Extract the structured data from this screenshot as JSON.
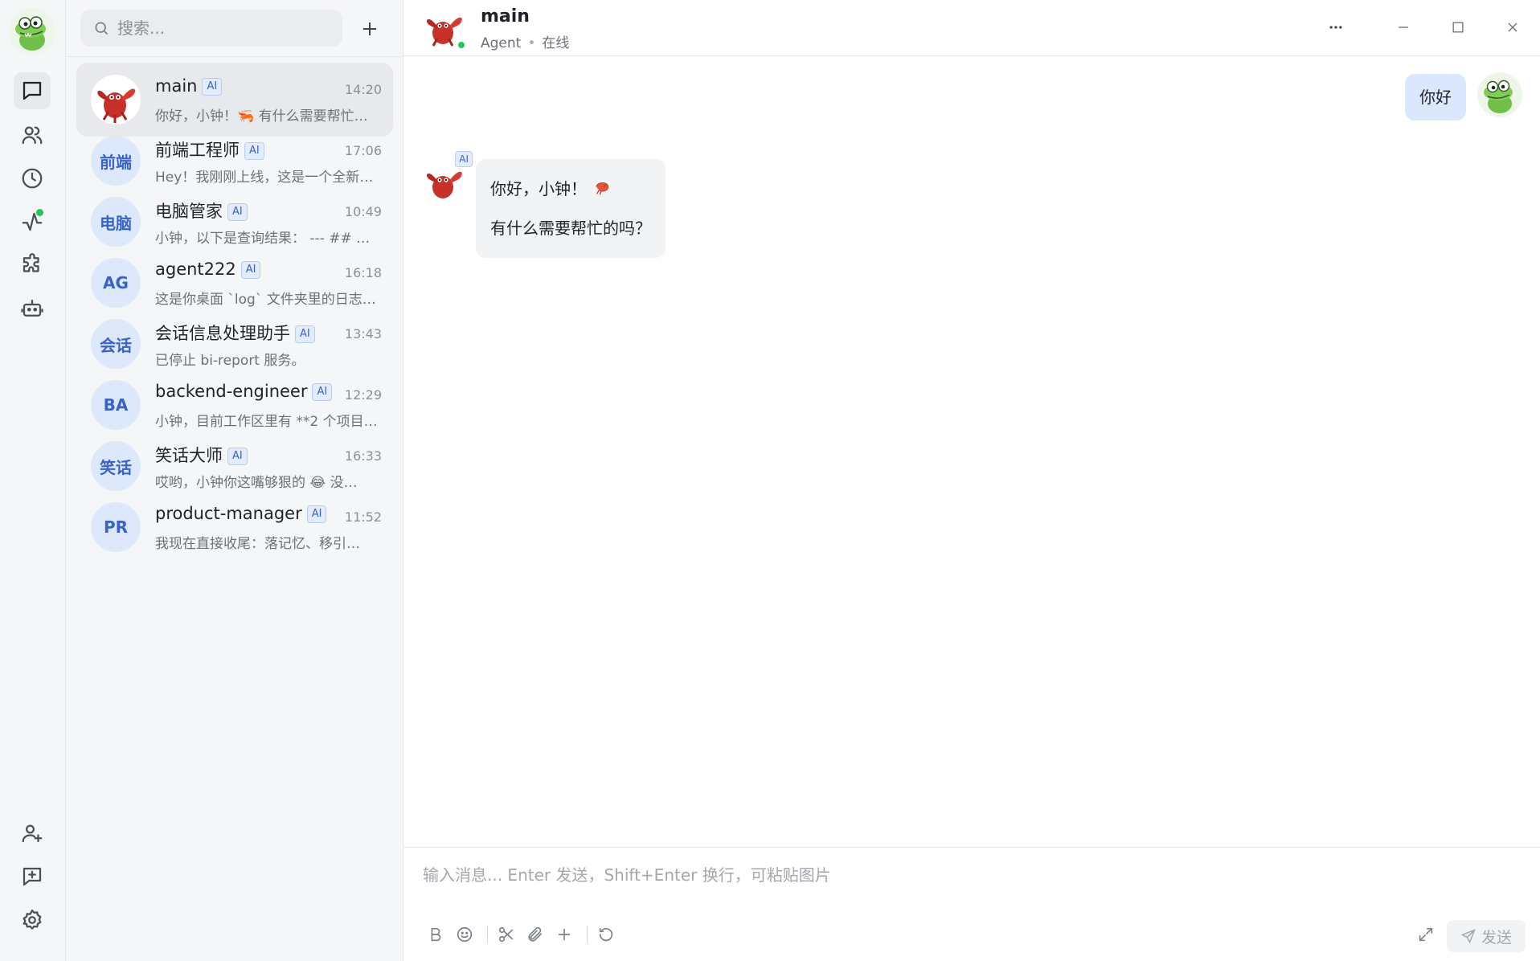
{
  "rail": {
    "items": [
      {
        "name": "chats",
        "icon": "chat-bubble-icon",
        "active": true
      },
      {
        "name": "contacts",
        "icon": "users-icon"
      },
      {
        "name": "history",
        "icon": "clock-icon"
      },
      {
        "name": "activity",
        "icon": "activity-icon",
        "badge": true
      },
      {
        "name": "plugins",
        "icon": "puzzle-icon"
      },
      {
        "name": "bots",
        "icon": "robot-icon"
      }
    ],
    "bottom_items": [
      {
        "name": "add-contact",
        "icon": "user-plus-icon"
      },
      {
        "name": "new-message",
        "icon": "message-plus-icon"
      },
      {
        "name": "settings",
        "icon": "gear-icon"
      }
    ]
  },
  "sidebar": {
    "search_placeholder": "搜索...",
    "conversations": [
      {
        "name": "main",
        "badge": "AI",
        "time": "14:20",
        "preview": "你好，小钟！🦐 有什么需要帮忙的吗？",
        "avatar_text": "",
        "active": true
      },
      {
        "name": "前端工程师",
        "badge": "AI",
        "time": "17:06",
        "preview": "Hey！我刚刚上线，这是一个全新的工作区…",
        "avatar_text": "前端"
      },
      {
        "name": "电脑管家",
        "badge": "AI",
        "time": "10:49",
        "preview": "小钟，以下是查询结果： --- ## …",
        "avatar_text": "电脑"
      },
      {
        "name": "agent222",
        "badge": "AI",
        "time": "16:18",
        "preview": "这是你桌面 `log` 文件夹里的日志…",
        "avatar_text": "AG"
      },
      {
        "name": "会话信息处理助手",
        "badge": "AI",
        "time": "13:43",
        "preview": "已停止 bi-report 服务。",
        "avatar_text": "会话"
      },
      {
        "name": "backend-engineer",
        "badge": "AI",
        "time": "12:29",
        "preview": "小钟，目前工作区里有 **2 个项目**…",
        "avatar_text": "BA"
      },
      {
        "name": "笑话大师",
        "badge": "AI",
        "time": "16:33",
        "preview": "哎哟，小钟你这嘴够狠的 😂 没…",
        "avatar_text": "笑话"
      },
      {
        "name": "product-manager",
        "badge": "AI",
        "time": "11:52",
        "preview": "我现在直接收尾：落记忆、移引…",
        "avatar_text": "PR"
      }
    ]
  },
  "header": {
    "title": "main",
    "subtitle_role": "Agent",
    "subtitle_sep": "•",
    "subtitle_status": "在线"
  },
  "messages": {
    "user_text": "你好",
    "bot_badge": "AI",
    "bot_line1": "你好，小钟！",
    "bot_line2": "有什么需要帮忙的吗？"
  },
  "composer": {
    "placeholder": "输入消息... Enter 发送，Shift+Enter 换行，可粘贴图片",
    "send_label": "发送"
  },
  "colors": {
    "accent": "#3a63c8",
    "online": "#22c55e",
    "user_bubble": "#dbe7fc",
    "bot_bubble": "#f2f3f5"
  }
}
